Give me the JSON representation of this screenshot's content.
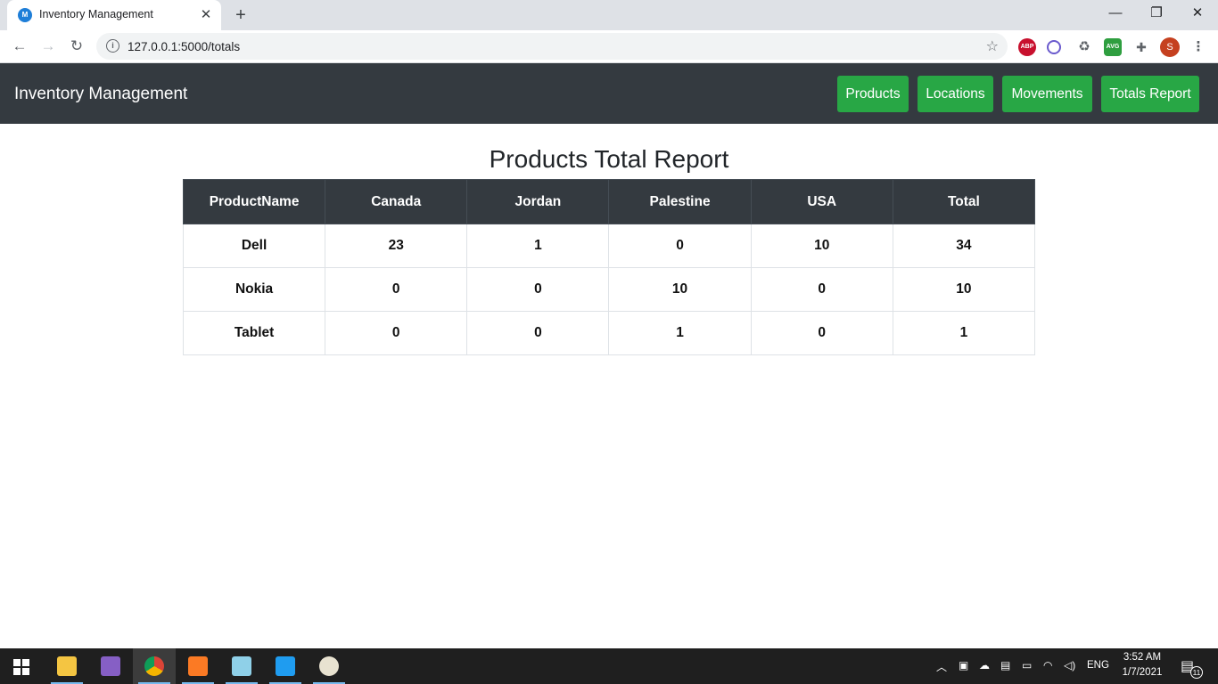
{
  "browser": {
    "tab_title": "Inventory Management",
    "url": "127.0.0.1:5000/totals",
    "avatar_letter": "S",
    "extension_abp": "ABP",
    "extension_avg": "AVG"
  },
  "app": {
    "brand": "Inventory Management",
    "nav": [
      {
        "label": "Products"
      },
      {
        "label": "Locations"
      },
      {
        "label": "Movements"
      },
      {
        "label": "Totals Report"
      }
    ]
  },
  "report": {
    "title": "Products Total Report",
    "headers": [
      "ProductName",
      "Canada",
      "Jordan",
      "Palestine",
      "USA",
      "Total"
    ],
    "rows": [
      [
        "Dell",
        "23",
        "1",
        "0",
        "10",
        "34"
      ],
      [
        "Nokia",
        "0",
        "0",
        "10",
        "0",
        "10"
      ],
      [
        "Tablet",
        "0",
        "0",
        "1",
        "0",
        "1"
      ]
    ]
  },
  "taskbar": {
    "language": "ENG",
    "time": "3:52 AM",
    "date": "1/7/2021",
    "notification_count": "11"
  },
  "colors": {
    "navbar_bg": "#343a40",
    "nav_button": "#28a745",
    "table_header_bg": "#343a40"
  }
}
